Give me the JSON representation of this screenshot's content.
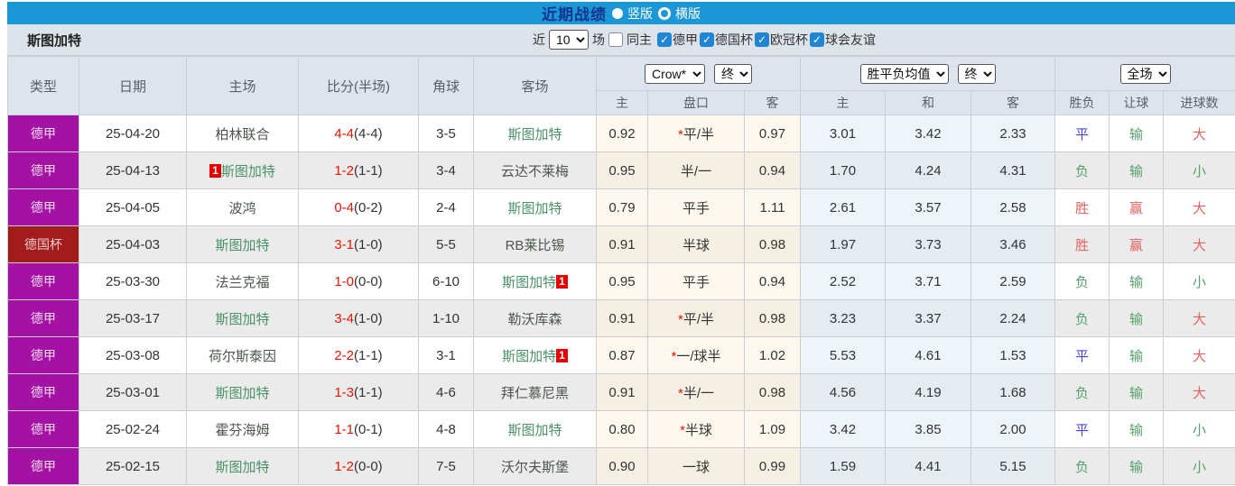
{
  "top_bar": {
    "title": "近期战绩",
    "radios": [
      {
        "label": "竖版",
        "selected": true
      },
      {
        "label": "横版",
        "selected": false
      }
    ]
  },
  "filter_bar": {
    "team": "斯图加特",
    "recent_label": "近",
    "recent_value": "10",
    "matches_label": "场",
    "same_home": {
      "label": "同主",
      "checked": false
    },
    "leagues": [
      {
        "label": "德甲",
        "checked": true
      },
      {
        "label": "德国杯",
        "checked": true
      },
      {
        "label": "欧冠杯",
        "checked": true
      },
      {
        "label": "球会友谊",
        "checked": true
      }
    ]
  },
  "table": {
    "selects": {
      "handicap_company": "Crow*",
      "handicap_time": "终",
      "odds_company": "胜平负均值",
      "odds_time": "终",
      "scope": "全场"
    },
    "columns": {
      "type": "类型",
      "date": "日期",
      "home": "主场",
      "score": "比分(半场)",
      "corners": "角球",
      "away": "客场",
      "ah_home": "主",
      "ah_line": "盘口",
      "ah_away": "客",
      "eu_home": "主",
      "eu_draw": "和",
      "eu_away": "客",
      "wdl": "胜负",
      "handicap_result": "让球",
      "goals": "进球数"
    },
    "rows": [
      {
        "league": "德甲",
        "date": "25-04-20",
        "home": {
          "name": "柏林联合",
          "focus": false,
          "card": null
        },
        "score": "4-4",
        "half": "(4-4)",
        "corners": "3-5",
        "away": {
          "name": "斯图加特",
          "focus": true,
          "card": null
        },
        "ah": {
          "home": "0.92",
          "star": true,
          "line": "平/半",
          "away": "0.97"
        },
        "eu": [
          "3.01",
          "3.42",
          "2.33"
        ],
        "results": [
          "平",
          "输",
          "大"
        ]
      },
      {
        "league": "德甲",
        "date": "25-04-13",
        "home": {
          "name": "斯图加特",
          "focus": true,
          "card": "before"
        },
        "score": "1-2",
        "half": "(1-1)",
        "corners": "3-4",
        "away": {
          "name": "云达不莱梅",
          "focus": false,
          "card": null
        },
        "ah": {
          "home": "0.95",
          "star": false,
          "line": "半/一",
          "away": "0.94"
        },
        "eu": [
          "1.70",
          "4.24",
          "4.31"
        ],
        "results": [
          "负",
          "输",
          "小"
        ]
      },
      {
        "league": "德甲",
        "date": "25-04-05",
        "home": {
          "name": "波鸿",
          "focus": false,
          "card": null
        },
        "score": "0-4",
        "half": "(0-2)",
        "corners": "2-4",
        "away": {
          "name": "斯图加特",
          "focus": true,
          "card": null
        },
        "ah": {
          "home": "0.79",
          "star": false,
          "line": "平手",
          "away": "1.11"
        },
        "eu": [
          "2.61",
          "3.57",
          "2.58"
        ],
        "results": [
          "胜",
          "赢",
          "大"
        ]
      },
      {
        "league": "德国杯",
        "date": "25-04-03",
        "home": {
          "name": "斯图加特",
          "focus": true,
          "card": null
        },
        "score": "3-1",
        "half": "(1-0)",
        "corners": "5-5",
        "away": {
          "name": "RB莱比锡",
          "focus": false,
          "card": null
        },
        "ah": {
          "home": "0.91",
          "star": false,
          "line": "半球",
          "away": "0.98"
        },
        "eu": [
          "1.97",
          "3.73",
          "3.46"
        ],
        "results": [
          "胜",
          "赢",
          "大"
        ]
      },
      {
        "league": "德甲",
        "date": "25-03-30",
        "home": {
          "name": "法兰克福",
          "focus": false,
          "card": null
        },
        "score": "1-0",
        "half": "(0-0)",
        "corners": "6-10",
        "away": {
          "name": "斯图加特",
          "focus": true,
          "card": "after"
        },
        "ah": {
          "home": "0.95",
          "star": false,
          "line": "平手",
          "away": "0.94"
        },
        "eu": [
          "2.52",
          "3.71",
          "2.59"
        ],
        "results": [
          "负",
          "输",
          "小"
        ]
      },
      {
        "league": "德甲",
        "date": "25-03-17",
        "home": {
          "name": "斯图加特",
          "focus": true,
          "card": null
        },
        "score": "3-4",
        "half": "(1-0)",
        "corners": "1-10",
        "away": {
          "name": "勒沃库森",
          "focus": false,
          "card": null
        },
        "ah": {
          "home": "0.91",
          "star": true,
          "line": "平/半",
          "away": "0.98"
        },
        "eu": [
          "3.23",
          "3.37",
          "2.24"
        ],
        "results": [
          "负",
          "输",
          "大"
        ]
      },
      {
        "league": "德甲",
        "date": "25-03-08",
        "home": {
          "name": "荷尔斯泰因",
          "focus": false,
          "card": null
        },
        "score": "2-2",
        "half": "(1-1)",
        "corners": "3-1",
        "away": {
          "name": "斯图加特",
          "focus": true,
          "card": "after"
        },
        "ah": {
          "home": "0.87",
          "star": true,
          "line": "一/球半",
          "away": "1.02"
        },
        "eu": [
          "5.53",
          "4.61",
          "1.53"
        ],
        "results": [
          "平",
          "输",
          "大"
        ]
      },
      {
        "league": "德甲",
        "date": "25-03-01",
        "home": {
          "name": "斯图加特",
          "focus": true,
          "card": null
        },
        "score": "1-3",
        "half": "(1-1)",
        "corners": "4-6",
        "away": {
          "name": "拜仁慕尼黑",
          "focus": false,
          "card": null
        },
        "ah": {
          "home": "0.91",
          "star": true,
          "line": "半/一",
          "away": "0.98"
        },
        "eu": [
          "4.56",
          "4.19",
          "1.68"
        ],
        "results": [
          "负",
          "输",
          "大"
        ]
      },
      {
        "league": "德甲",
        "date": "25-02-24",
        "home": {
          "name": "霍芬海姆",
          "focus": false,
          "card": null
        },
        "score": "1-1",
        "half": "(0-1)",
        "corners": "4-8",
        "away": {
          "name": "斯图加特",
          "focus": true,
          "card": null
        },
        "ah": {
          "home": "0.80",
          "star": true,
          "line": "半球",
          "away": "1.09"
        },
        "eu": [
          "3.42",
          "3.85",
          "2.00"
        ],
        "results": [
          "平",
          "输",
          "小"
        ]
      },
      {
        "league": "德甲",
        "date": "25-02-15",
        "home": {
          "name": "斯图加特",
          "focus": true,
          "card": null
        },
        "score": "1-2",
        "half": "(0-0)",
        "corners": "7-5",
        "away": {
          "name": "沃尔夫斯堡",
          "focus": false,
          "card": null
        },
        "ah": {
          "home": "0.90",
          "star": false,
          "line": "一球",
          "away": "0.99"
        },
        "eu": [
          "1.59",
          "4.41",
          "5.15"
        ],
        "results": [
          "负",
          "输",
          "小"
        ]
      }
    ]
  },
  "icons": {
    "check": "✓",
    "star": "*",
    "red_card_text": "1"
  },
  "palette": {
    "topbar_bg": "#1b96d6",
    "title_color": "#12378f",
    "league_colors": {
      "德甲": "#a312a3",
      "德国杯": "#a21c1c"
    },
    "league_text_colors": {
      "德甲": "#f6dcf6",
      "德国杯": "#f3caca"
    },
    "result_colors": {
      "胜": "#e4625f",
      "赢": "#e4625f",
      "大": "#e4625f",
      "平": "#4343d9",
      "负": "#55a06b",
      "输": "#55a06b",
      "小": "#55a06b"
    },
    "score_red": "#e81300",
    "team_focus_color": "#4a9168",
    "card_bg": "#e60000"
  }
}
